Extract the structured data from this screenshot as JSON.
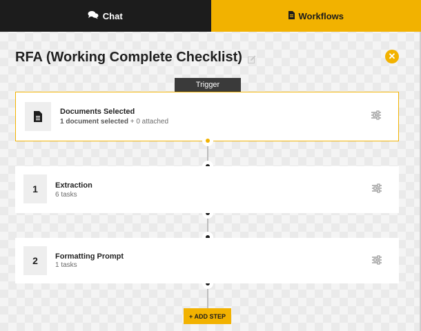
{
  "tabs": {
    "chat_label": "Chat",
    "workflows_label": "Workflows",
    "active": "Workflows"
  },
  "workflow": {
    "title": "RFA (Working Complete Checklist)"
  },
  "trigger": {
    "label": "Trigger",
    "title": "Documents Selected",
    "sub_count": "1 document selected",
    "sub_extra": "+ 0 attached"
  },
  "steps": [
    {
      "number": "1",
      "title": "Extraction",
      "subtitle": "6 tasks"
    },
    {
      "number": "2",
      "title": "Formatting Prompt",
      "subtitle": "1 tasks"
    }
  ],
  "add_step_label": "+ ADD STEP",
  "colors": {
    "accent": "#f2b200",
    "dark": "#1c1c1c"
  },
  "icons": [
    "chat-icon",
    "document-icon",
    "edit-icon",
    "close-icon",
    "file-icon",
    "settings-icon"
  ]
}
